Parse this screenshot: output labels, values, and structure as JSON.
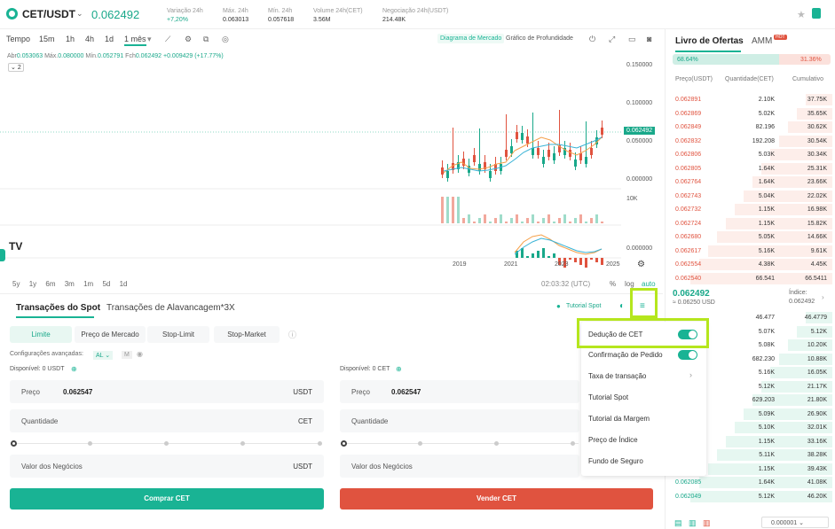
{
  "header": {
    "pair": "CET/USDT",
    "price": "0.062492",
    "stats": [
      {
        "label": "Variação 24h",
        "value": "+7,20%"
      },
      {
        "label": "Máx. 24h",
        "value": "0.063013"
      },
      {
        "label": "Mín. 24h",
        "value": "0.057618"
      },
      {
        "label": "Volume 24h(CET)",
        "value": "3.56M"
      },
      {
        "label": "Negociação 24h(USDT)",
        "value": "214.48K"
      }
    ]
  },
  "chart": {
    "intervals": [
      "Tempo",
      "15m",
      "1h",
      "4h",
      "1d",
      "1 mês"
    ],
    "active": "1 mês",
    "mode_a": "Diagrama de Mercado",
    "mode_b": "Gráfico de Profundidade",
    "ohlc": {
      "o_label": "Abr",
      "o": "0.053063",
      "h_label": "Máx.",
      "h": "0.080000",
      "l_label": "Mín.",
      "l": "0.052791",
      "c_label": "Fch",
      "c": "0.062492",
      "chg": "+0.009429 (+17.77%)"
    },
    "indicator_count": "2",
    "yticks": [
      "0.150000",
      "0.100000",
      "0.050000",
      "0.000000"
    ],
    "current_price": "0.062492",
    "vol_tick": "10K",
    "macd_tick": "0.000000",
    "xticks": [
      "2019",
      "2021",
      "2023",
      "2025"
    ],
    "ranges": [
      "5y",
      "1y",
      "6m",
      "3m",
      "1m",
      "5d",
      "1d"
    ],
    "clock": "02:03:32 (UTC)",
    "opt_pct": "%",
    "opt_log": "log",
    "opt_auto": "auto"
  },
  "orderbook": {
    "tab": "Livro de Ofertas",
    "amm": "AMM",
    "hot": "HOT",
    "buy_pct": "68.64%",
    "sell_pct": "31.36%",
    "cols": [
      "Preço(USDT)",
      "Quantidade(CET)",
      "Cumulativo"
    ],
    "asks": [
      [
        "0.062891",
        "2.10K",
        "37.75K"
      ],
      [
        "0.062869",
        "5.02K",
        "35.65K"
      ],
      [
        "0.062849",
        "82.196",
        "30.62K"
      ],
      [
        "0.062832",
        "192.208",
        "30.54K"
      ],
      [
        "0.062806",
        "5.03K",
        "30.34K"
      ],
      [
        "0.062805",
        "1.64K",
        "25.31K"
      ],
      [
        "0.062764",
        "1.64K",
        "23.66K"
      ],
      [
        "0.062743",
        "5.04K",
        "22.02K"
      ],
      [
        "0.062732",
        "1.15K",
        "16.98K"
      ],
      [
        "0.062724",
        "1.15K",
        "15.82K"
      ],
      [
        "0.062680",
        "5.05K",
        "14.66K"
      ],
      [
        "0.062617",
        "5.16K",
        "9.61K"
      ],
      [
        "0.062554",
        "4.38K",
        "4.45K"
      ],
      [
        "0.062540",
        "66.541",
        "66.5411"
      ]
    ],
    "mid": "0.062492",
    "mid_usd": "≈ 0.06250 USD",
    "index_label": "Índice:",
    "index_val": "0.062492",
    "bids": [
      [
        "",
        "46.477",
        "46.4779"
      ],
      [
        "",
        "5.07K",
        "5.12K"
      ],
      [
        "",
        "5.08K",
        "10.20K"
      ],
      [
        "",
        "682.230",
        "10.88K"
      ],
      [
        "",
        "5.16K",
        "16.05K"
      ],
      [
        "",
        "5.12K",
        "21.17K"
      ],
      [
        "",
        "629.203",
        "21.80K"
      ],
      [
        "",
        "5.09K",
        "26.90K"
      ],
      [
        "",
        "5.10K",
        "32.01K"
      ],
      [
        "",
        "1.15K",
        "33.16K"
      ],
      [
        "",
        "5.11K",
        "38.28K"
      ],
      [
        "",
        "1.15K",
        "39.43K"
      ],
      [
        "0.062085",
        "1.64K",
        "41.08K"
      ],
      [
        "0.062049",
        "5.12K",
        "46.20K"
      ]
    ],
    "precision": "0.000001"
  },
  "trade": {
    "tab_spot": "Transações do Spot",
    "tab_margin": "Transações de Alavancagem*3X",
    "tutorial": "Tutorial Spot",
    "types": [
      "Limite",
      "Preço de Mercado",
      "Stop-Limit",
      "Stop-Market"
    ],
    "adv": "Configurações avançadas:",
    "adv_al": "AL",
    "adv_m": "M",
    "avail_buy": "Disponível: 0 USDT",
    "avail_sell": "Disponível: 0 CET",
    "price_label": "Preço",
    "price_val": "0.062547",
    "usdt": "USDT",
    "qty_label": "Quantidade",
    "cet": "CET",
    "value_label": "Valor dos Negócios",
    "buy": "Comprar CET",
    "sell": "Vender CET"
  },
  "menu": [
    "Dedução de CET",
    "Confirmação de Pedido",
    "Taxa de transação",
    "Tutorial Spot",
    "Tutorial da Margem",
    "Preço de Índice",
    "Fundo de Seguro"
  ],
  "colors": {
    "accent": "#19b394",
    "down": "#e0533f",
    "highlight": "#b5e61d"
  }
}
